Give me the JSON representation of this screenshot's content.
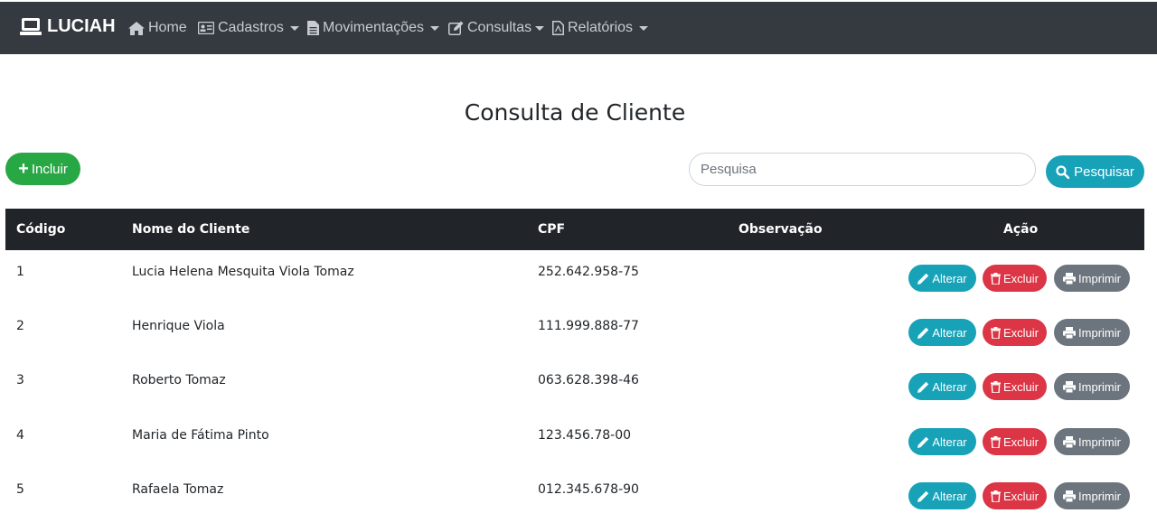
{
  "navbar": {
    "brand": "LUCIAH",
    "items": [
      {
        "label": "Home"
      },
      {
        "label": "Cadastros"
      },
      {
        "label": "Movimentações"
      },
      {
        "label": "Consultas"
      },
      {
        "label": "Relatórios"
      }
    ]
  },
  "page": {
    "title": "Consulta de Cliente",
    "include_label": "Incluir",
    "search": {
      "placeholder": "Pesquisa",
      "value": ""
    },
    "search_button_label": "Pesquisar"
  },
  "table": {
    "headers": [
      "Código",
      "Nome do Cliente",
      "CPF",
      "Observação",
      "Ação"
    ],
    "rows": [
      {
        "codigo": "1",
        "nome": "Lucia Helena Mesquita Viola Tomaz",
        "cpf": "252.642.958-75",
        "obs": ""
      },
      {
        "codigo": "2",
        "nome": "Henrique Viola",
        "cpf": "111.999.888-77",
        "obs": ""
      },
      {
        "codigo": "3",
        "nome": "Roberto Tomaz",
        "cpf": "063.628.398-46",
        "obs": ""
      },
      {
        "codigo": "4",
        "nome": "Maria de Fátima Pinto",
        "cpf": "123.456.78-00",
        "obs": ""
      },
      {
        "codigo": "5",
        "nome": "Rafaela Tomaz",
        "cpf": "012.345.678-90",
        "obs": ""
      }
    ],
    "actions": {
      "alterar": "Alterar",
      "excluir": "Excluir",
      "imprimir": "Imprimir"
    }
  },
  "colors": {
    "navbar": "#343a40",
    "success": "#28a745",
    "info": "#17a2b8",
    "danger": "#dc3545",
    "secondary": "#6c757d",
    "table_head": "#212529"
  }
}
